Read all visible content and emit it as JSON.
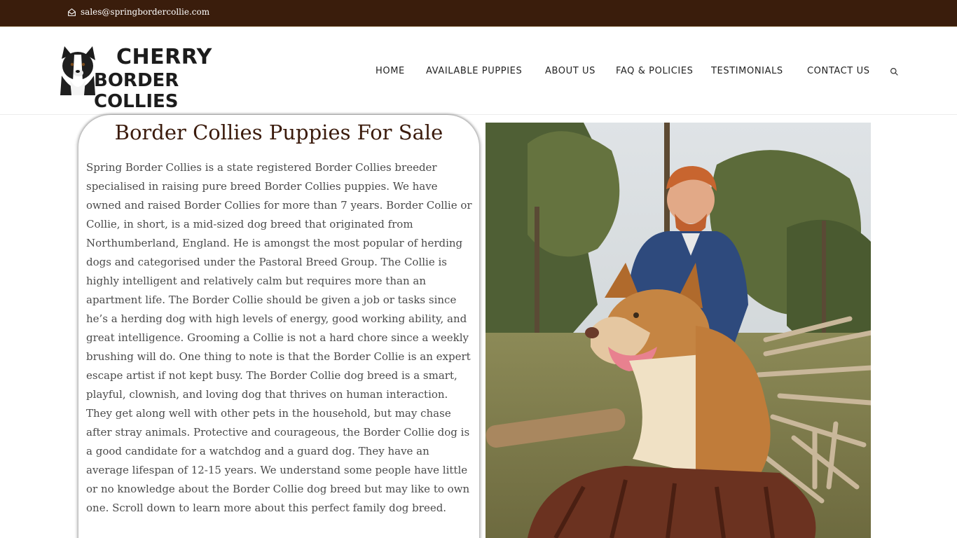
{
  "topbar": {
    "email": "sales@springbordercollie.com",
    "email_icon": "envelope-icon",
    "bg_color": "#3a1d0c"
  },
  "logo": {
    "line1": "CHERRY",
    "line2": "BORDER COLLIES",
    "image": "border-collie-logo-dog"
  },
  "nav": {
    "items": [
      {
        "label": "HOME"
      },
      {
        "label": "AVAILABLE PUPPIES"
      },
      {
        "label": "ABOUT US"
      },
      {
        "label": "FAQ & POLICIES"
      },
      {
        "label": "TESTIMONIALS"
      },
      {
        "label": "CONTACT US"
      }
    ],
    "search_icon": "search-icon"
  },
  "main": {
    "title": "Border Collies Puppies For Sale",
    "body": "Spring Border Collies is a state registered Border Collies breeder specialised in raising pure breed Border Collies puppies. We have owned and raised Border Collies for more than 7 years. Border Collie or Collie, in short, is a mid-sized dog breed that originated from Northumberland, England. He is amongst the most popular of herding dogs and categorised under the Pastoral Breed Group. The Collie is highly intelligent and relatively calm but requires more than an apartment life. The Border Collie should be given a job or tasks since he’s a herding dog with high levels of energy, good working ability, and great intelligence. Grooming a Collie is not a hard chore since a weekly brushing will do. One thing to note is that the Border Collie is an expert escape artist if not kept busy. The Border Collie dog breed is a smart, playful, clownish, and loving dog that thrives on human interaction. They get along well with other pets in the household, but may chase after stray animals. Protective and courageous, the Border Collie dog is a good candidate for a watchdog and a guard dog. They have an average lifespan of 12-15 years.  We understand some people have little or no knowledge about the Border Collie dog breed but may like to own one. Scroll down to learn more about this perfect family dog breed.",
    "title_color": "#3b1b0c"
  },
  "photo": {
    "subject": "man-with-red-merle-border-collie-photo"
  }
}
